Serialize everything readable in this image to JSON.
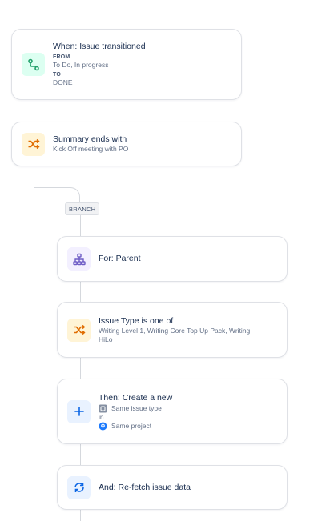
{
  "trigger": {
    "title": "When: Issue transitioned",
    "from_label": "FROM",
    "from_value": "To Do, In progress",
    "to_label": "TO",
    "to_value": "DONE",
    "icon": "transition-icon"
  },
  "condition1": {
    "title": "Summary ends with",
    "value": "Kick Off meeting with PO",
    "icon": "shuffle-icon"
  },
  "branch": {
    "tag": "BRANCH"
  },
  "for_parent": {
    "title": "For: Parent",
    "icon": "hierarchy-icon"
  },
  "condition2": {
    "title": "Issue Type is one of",
    "value": "Writing Level 1, Writing Core Top Up Pack, Writing HiLo",
    "icon": "shuffle-icon"
  },
  "create": {
    "title": "Then: Create a new",
    "issue_type": "Same issue type",
    "in_label": "in",
    "project": "Same project",
    "icon": "plus-icon"
  },
  "refetch": {
    "title": "And: Re-fetch issue data",
    "icon": "refresh-icon"
  },
  "colors": {
    "green_icon": "#22a06b",
    "orange_icon": "#e06c00",
    "purple_icon": "#6e5dc6",
    "blue_icon": "#0c66e4"
  }
}
